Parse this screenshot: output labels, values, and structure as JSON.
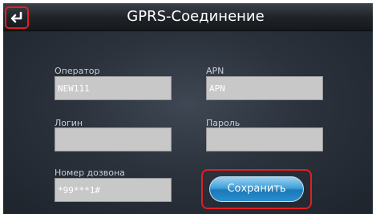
{
  "header": {
    "title": "GPRS-Соединение",
    "back_icon": "return-arrow-icon"
  },
  "form": {
    "operator": {
      "label": "Оператор",
      "value": "NEW111"
    },
    "apn": {
      "label": "APN",
      "value": "APN"
    },
    "login": {
      "label": "Логин",
      "value": ""
    },
    "password": {
      "label": "Пароль",
      "value": ""
    },
    "dial_number": {
      "label": "Номер дозвона",
      "value": "*99***1#"
    }
  },
  "actions": {
    "save_label": "Сохранить"
  },
  "colors": {
    "highlight": "#e02020",
    "button_blue": "#2a8fcf",
    "panel_bg": "#2b323c"
  }
}
